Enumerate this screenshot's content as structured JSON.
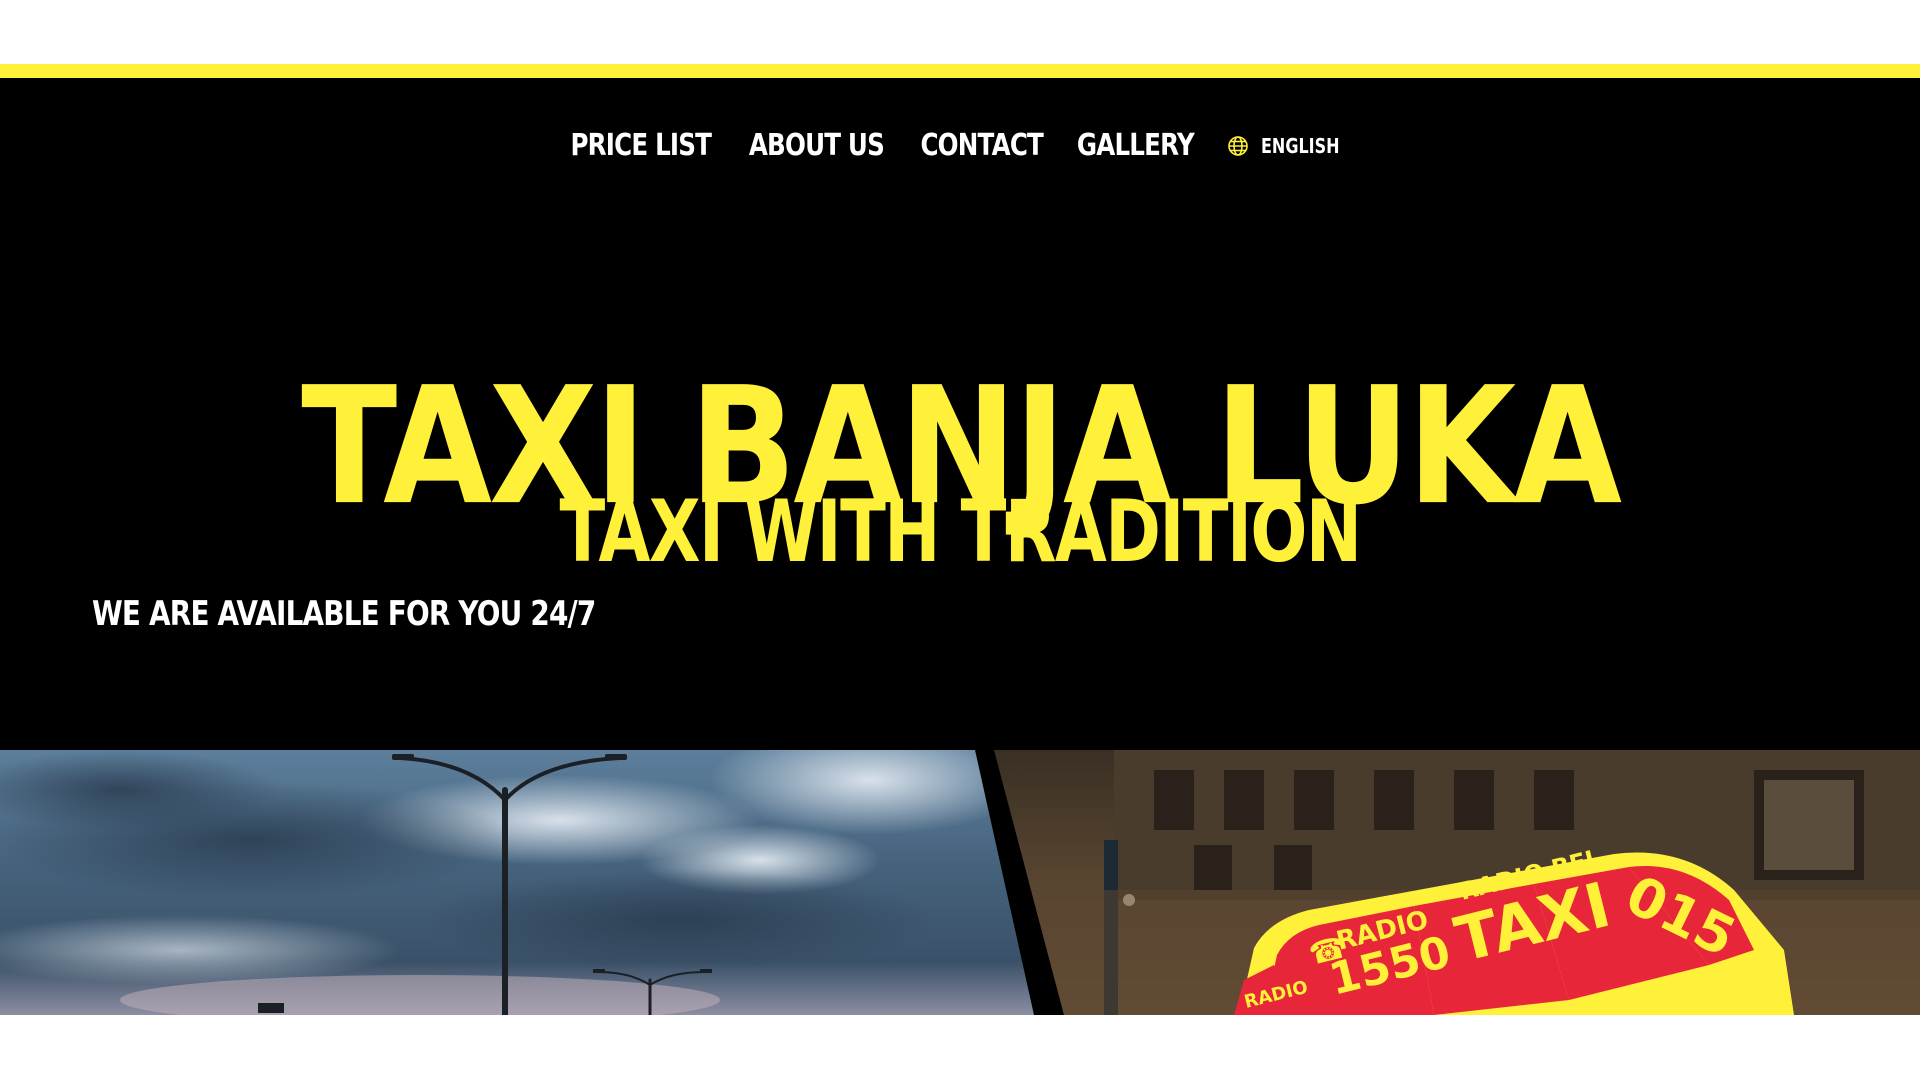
{
  "colors": {
    "accent_yellow": "#fff03a",
    "background": "#000000",
    "nav_text": "#ffffff"
  },
  "nav": {
    "links": [
      "PRICE LIST",
      "ABOUT US",
      "CONTACT",
      "GALLERY"
    ],
    "language": {
      "icon": "globe-icon",
      "label": "ENGLISH"
    }
  },
  "hero": {
    "title": "TAXI BANJA LUKA",
    "subtitle": "TAXI WITH TRADITION",
    "tagline": "WE ARE AVAILABLE FOR YOU 24/7"
  },
  "images": {
    "left": "Highway street lamps under a cloudy evening sky",
    "right": "Illuminated roof sign of a taxi car at night on a city street",
    "taxi_sign": {
      "radio_text": "RADIO",
      "phone_number": "1550",
      "brand_text": "RADIO BEL",
      "taxi_text": "TAXI",
      "short_number": "015"
    }
  }
}
